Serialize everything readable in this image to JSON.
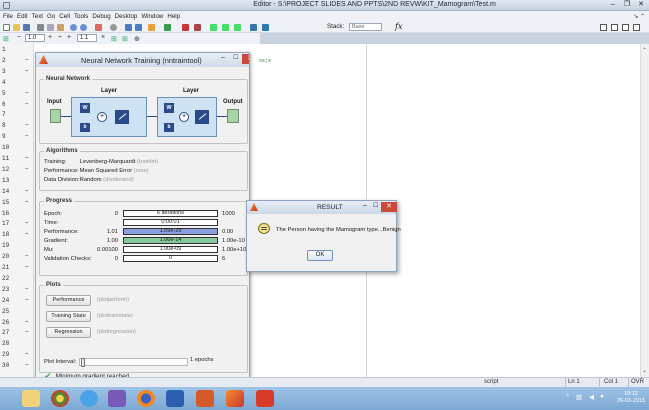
{
  "window": {
    "title": "Editor - S:\\PROJECT SLIDES AND PPTS\\2ND REVW\\KIT_Mamogram\\Test.m"
  },
  "menu": [
    "File",
    "Edit",
    "Text",
    "Go",
    "Cell",
    "Tools",
    "Debug",
    "Desktop",
    "Window",
    "Help"
  ],
  "toolbar": {
    "stack_label": "Stack:",
    "stack_value": "Base",
    "fx": "fx"
  },
  "cellbar": {
    "minus": "−",
    "val1": "1.0",
    "plus": "+",
    "div": "÷",
    "val2": "1.1",
    "x": "×"
  },
  "editor": {
    "line_numbers": [
      "1",
      "2",
      "3",
      "4",
      "5",
      "6",
      "7",
      "8",
      "9",
      "10",
      "11",
      "12",
      "13",
      "14",
      "15",
      "16",
      "17",
      "18",
      "19",
      "20",
      "21",
      "22",
      "23",
      "24",
      "25",
      "26",
      "27",
      "28",
      "29",
      "30"
    ],
    "snippet": "ss;s"
  },
  "nntool": {
    "title": "Neural Network Training (nntraintool)",
    "network": {
      "section": "Neural Network",
      "input": "Input",
      "layer1": "Layer",
      "layer2": "Layer",
      "output": "Output",
      "w": "W",
      "b": "b",
      "plus": "+"
    },
    "algorithms": {
      "section": "Algorithms",
      "rows": [
        {
          "k": "Training:",
          "v": "Levenberg-Marquardt",
          "g": "(trainlm)"
        },
        {
          "k": "Performance:",
          "v": "Mean Squared Error",
          "g": "(mse)"
        },
        {
          "k": "Data Division:",
          "v": "Random",
          "g": "(dividerand)"
        }
      ]
    },
    "progress": {
      "section": "Progress",
      "rows": [
        {
          "k": "Epoch:",
          "min": "0",
          "bar": "6 iterations",
          "max": "1000",
          "style": "white"
        },
        {
          "k": "Time:",
          "min": "",
          "bar": "0:00:01",
          "max": "",
          "style": "white"
        },
        {
          "k": "Performance:",
          "min": "1.01",
          "bar": "1.09e-29",
          "max": "0.00",
          "style": "blue"
        },
        {
          "k": "Gradient:",
          "min": "1.00",
          "bar": "1.06e-14",
          "max": "1.00e-10",
          "style": "green"
        },
        {
          "k": "Mu:",
          "min": "0.00100",
          "bar": "1.00e-09",
          "max": "1.00e+10",
          "style": "white"
        },
        {
          "k": "Validation Checks:",
          "min": "0",
          "bar": "0",
          "max": "6",
          "style": "white"
        }
      ]
    },
    "plots": {
      "section": "Plots",
      "buttons": [
        {
          "label": "Performance",
          "fn": "(plotperform)"
        },
        {
          "label": "Training State",
          "fn": "(plottrainstate)"
        },
        {
          "label": "Regression",
          "fn": "(plotregression)"
        }
      ],
      "interval_label": "Plot Interval:",
      "interval_value": "1 epochs"
    },
    "status": "Minimum gradient reached"
  },
  "dialog": {
    "title": "RESULT",
    "message": "The Person having the Mamogram type...Benign",
    "ok": "OK"
  },
  "statusbar": {
    "mode": "script",
    "ln": "Ln 1",
    "col": "Col 1",
    "ovr": "OVR"
  },
  "taskbar": {
    "time": "18:12",
    "date": "26-03-2015"
  }
}
